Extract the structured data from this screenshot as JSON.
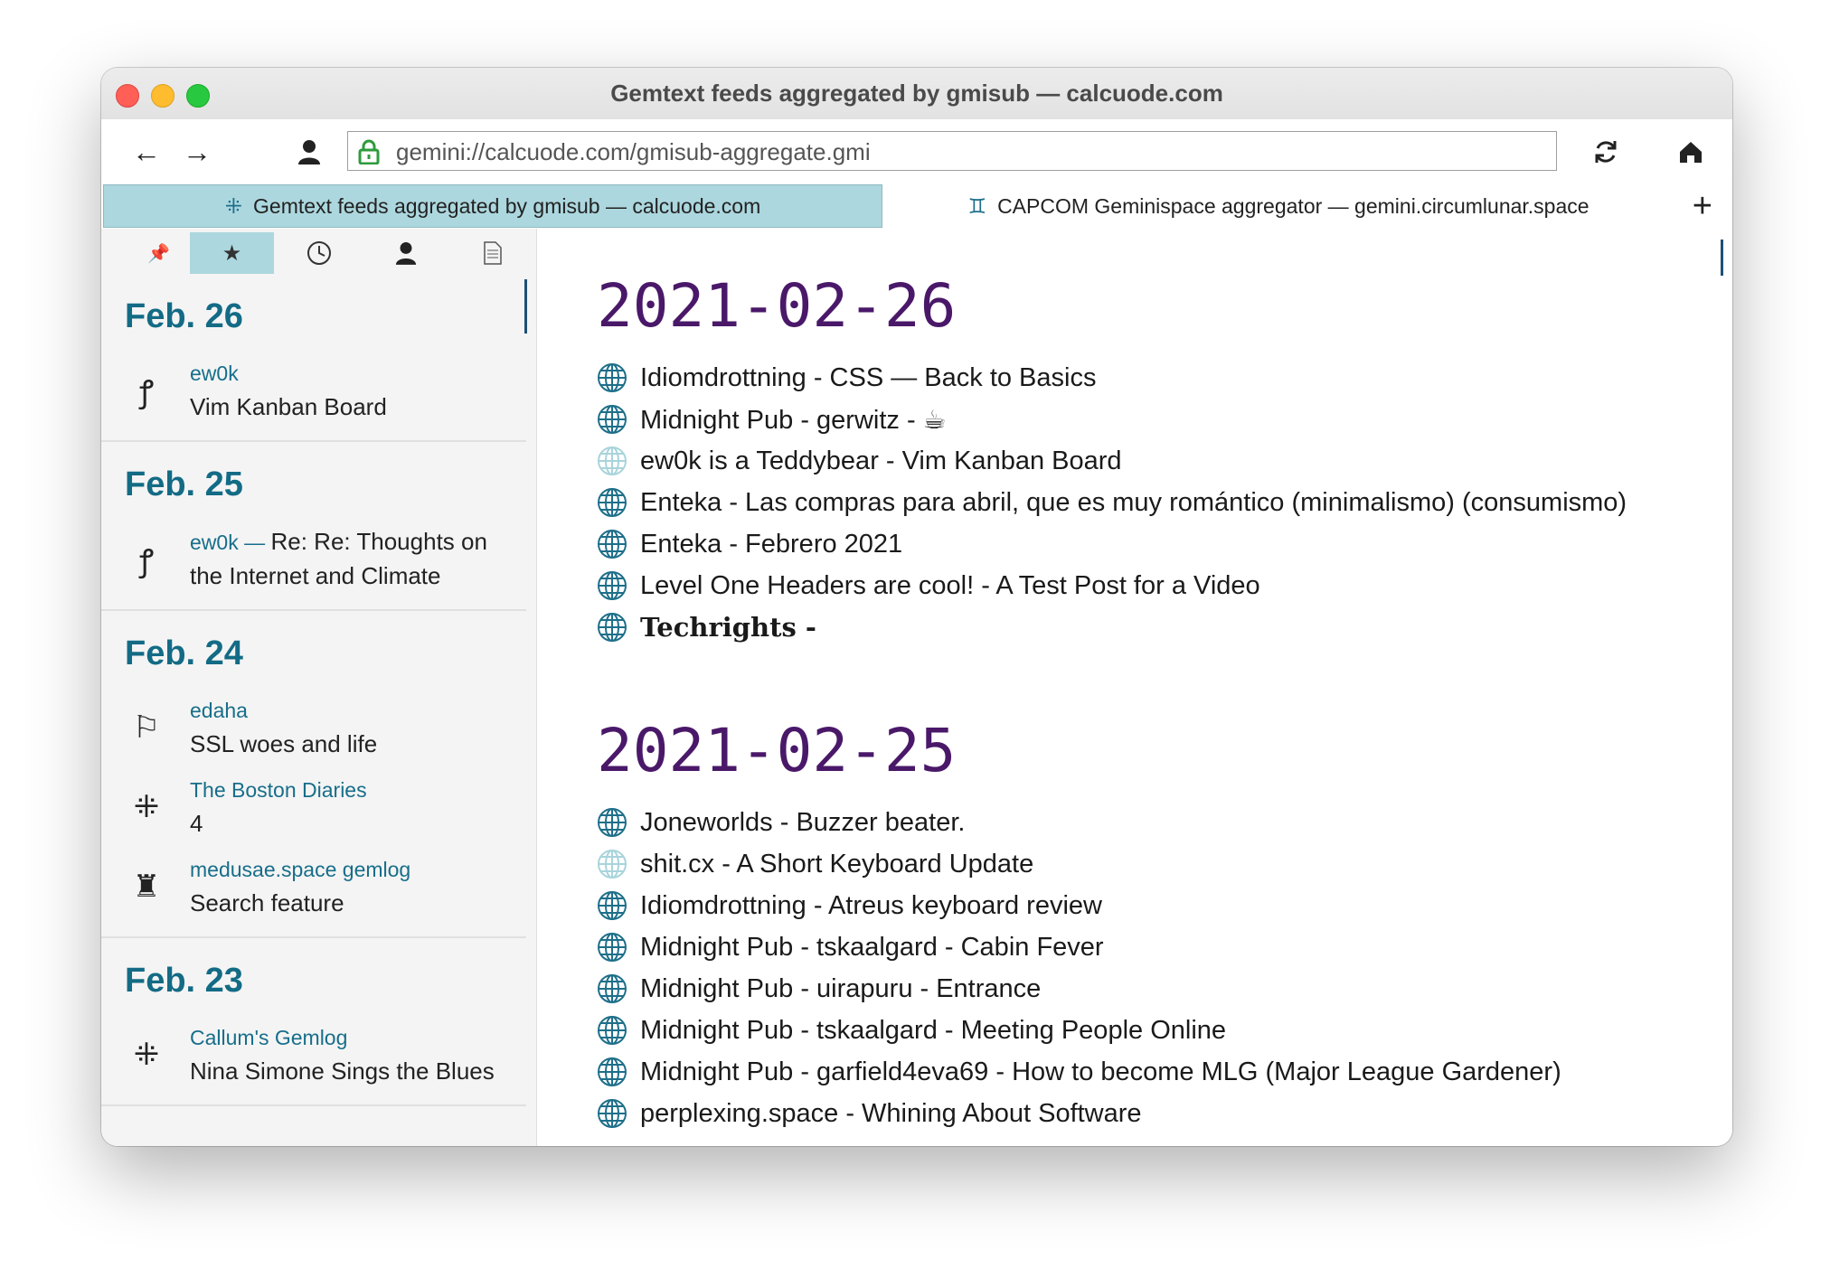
{
  "window": {
    "title": "Gemtext feeds aggregated by gmisub — calcuode.com"
  },
  "toolbar": {
    "back_icon": "←",
    "forward_icon": "→",
    "identity_icon": "👤",
    "url": "gemini://calcuode.com/gmisub-aggregate.gmi",
    "reload_icon": "⟳",
    "home_icon": "⌂"
  },
  "tabs": [
    {
      "icon": "⁜",
      "label": "Gemtext feeds aggregated by gmisub — calcuode.com"
    },
    {
      "icon": "♊",
      "label": "CAPCOM Geminispace aggregator — gemini.circumlunar.space"
    }
  ],
  "new_tab_icon": "+",
  "sidebar": {
    "tab_icons": [
      "📌",
      "★",
      "🕓",
      "👤",
      "📄"
    ],
    "days": [
      {
        "label": "Feb. 26",
        "entries": [
          {
            "icon": "ꝭ",
            "feed": "ew0k",
            "title": "Vim Kanban Board"
          }
        ]
      },
      {
        "label": "Feb. 25",
        "entries": [
          {
            "icon": "ꝭ",
            "feed": "ew0k —",
            "title_inline": "Re: Re: Thoughts on",
            "title": "the Internet and Climate"
          }
        ]
      },
      {
        "label": "Feb. 24",
        "entries": [
          {
            "icon": "⚐",
            "feed": "edaha",
            "title": "SSL woes and life"
          },
          {
            "icon": "⁜",
            "feed": "The Boston Diaries",
            "title": "4"
          },
          {
            "icon": "♜",
            "feed": "medusae.space gemlog",
            "title": "Search feature"
          }
        ]
      },
      {
        "label": "Feb. 23",
        "entries": [
          {
            "icon": "⁜",
            "feed": "Callum's Gemlog",
            "title": "Nina Simone Sings the Blues"
          }
        ]
      }
    ]
  },
  "content": {
    "sections": [
      {
        "heading": "2021-02-26",
        "links": [
          {
            "text": "Idiomdrottning - CSS — Back to Basics",
            "visited": false
          },
          {
            "text": "Midnight Pub - gerwitz - ☕",
            "visited": false
          },
          {
            "text": "ew0k is a Teddybear - Vim Kanban Board",
            "visited": true
          },
          {
            "text": "Enteka - Las compras para abril, que es muy romántico (minimalismo) (consumismo)",
            "visited": false
          },
          {
            "text": "Enteka - Febrero 2021",
            "visited": false
          },
          {
            "text": "Level One Headers are cool! - A Test Post for a Video",
            "visited": false
          },
          {
            "text": "Techrights -",
            "visited": false,
            "gothic": true
          }
        ]
      },
      {
        "heading": "2021-02-25",
        "links": [
          {
            "text": "Joneworlds - Buzzer beater.",
            "visited": false
          },
          {
            "text": "shit.cx - A Short Keyboard Update",
            "visited": true
          },
          {
            "text": "Idiomdrottning - Atreus keyboard review",
            "visited": false
          },
          {
            "text": "Midnight Pub - tskaalgard - Cabin Fever",
            "visited": false
          },
          {
            "text": "Midnight Pub - uirapuru - Entrance",
            "visited": false
          },
          {
            "text": "Midnight Pub - tskaalgard - Meeting People Online",
            "visited": false
          },
          {
            "text": "Midnight Pub - garfield4eva69 - How to become MLG (Major League Gardener)",
            "visited": false
          },
          {
            "text": "perplexing.space - Whining About Software",
            "visited": false
          }
        ]
      }
    ]
  },
  "colors": {
    "accent": "#acd7de",
    "heading": "#4a1869",
    "feed_link": "#176e8a",
    "globe": "#1e6f8a",
    "globe_visited": "#a9d4dc"
  }
}
